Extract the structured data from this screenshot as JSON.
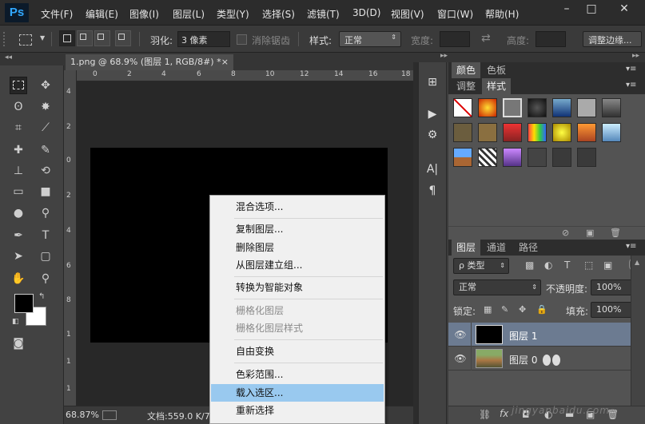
{
  "menubar": {
    "logo": "Ps",
    "items": [
      "文件(F)",
      "编辑(E)",
      "图像(I)",
      "图层(L)",
      "类型(Y)",
      "选择(S)",
      "滤镜(T)",
      "3D(D)",
      "视图(V)",
      "窗口(W)",
      "帮助(H)"
    ],
    "window_buttons": [
      "–",
      "□",
      "✕"
    ]
  },
  "options": {
    "feather_label": "羽化:",
    "feather_value": "3 像素",
    "antialias_label": "消除锯齿",
    "style_label": "样式:",
    "style_value": "正常",
    "width_label": "宽度:",
    "height_label": "高度:",
    "refine_button": "调整边缘..."
  },
  "document": {
    "tab_title": "1.png @ 68.9% (图层 1, RGB/8#) *",
    "tab_close": "×",
    "ruler_h": [
      "0",
      "2",
      "4",
      "6",
      "8",
      "10",
      "12",
      "14",
      "16",
      "18"
    ],
    "ruler_v": [
      "4",
      "2",
      "0",
      "2",
      "4",
      "6",
      "8",
      "1",
      "1",
      "1"
    ],
    "zoom": "68.87%",
    "status": "文档:559.0 K/74"
  },
  "context_menu": {
    "items": [
      {
        "label": "混合选项...",
        "disabled": false
      },
      {
        "label": "复制图层...",
        "disabled": false
      },
      {
        "label": "删除图层",
        "disabled": false
      },
      {
        "label": "从图层建立组...",
        "disabled": false
      },
      {
        "label": "转换为智能对象",
        "disabled": false
      },
      {
        "label": "栅格化图层",
        "disabled": true
      },
      {
        "label": "栅格化图层样式",
        "disabled": true
      },
      {
        "label": "自由变换",
        "disabled": false
      },
      {
        "label": "色彩范围...",
        "disabled": false
      },
      {
        "label": "载入选区...",
        "disabled": false
      },
      {
        "label": "重新选择",
        "disabled": false
      }
    ]
  },
  "panels": {
    "color_tabs": [
      "颜色",
      "色板"
    ],
    "style_tabs": [
      "调整",
      "样式"
    ],
    "layer_tabs": [
      "图层",
      "通道",
      "路径"
    ],
    "filter_kind": "ρ 类型",
    "blend_mode": "正常",
    "opacity_label": "不透明度:",
    "opacity_value": "100%",
    "lock_label": "锁定:",
    "fill_label": "填充:",
    "fill_value": "100%",
    "layers": [
      {
        "name": "图层 1",
        "selected": true
      },
      {
        "name": "图层 0",
        "selected": false
      }
    ]
  },
  "colors": {
    "highlight": "#99c9ef",
    "selected_layer": "#6c7b91",
    "ps_blue": "#31a8ff"
  },
  "watermark": "jingyanbaidu.com"
}
